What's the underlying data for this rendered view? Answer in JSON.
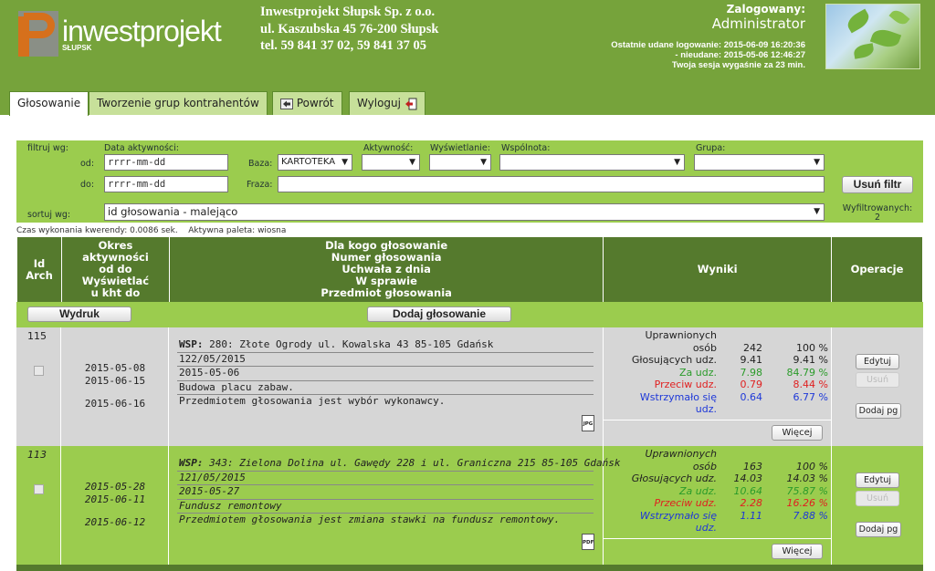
{
  "header": {
    "logo_text": "inwestprojekt",
    "logo_sub": "SŁUPSK",
    "company_name": "Inwestprojekt Słupsk Sp. z o.o.",
    "company_address": "ul. Kaszubska 45 76-200 Słupsk",
    "company_phone": "tel. 59 841 37 02, 59 841 37 05",
    "logged_label": "Zalogowany:",
    "logged_user": "Administrator",
    "last_ok_login": "Ostatnie udane logowanie: 2015-06-09 16:20:36",
    "last_failed_login": "- nieudane: 2015-05-06 12:46:27",
    "session_expiry": "Twoja sesja wygaśnie za 23 min."
  },
  "tabs": [
    {
      "label": "Głosowanie",
      "active": true
    },
    {
      "label": "Tworzenie grup kontrahentów",
      "active": false
    },
    {
      "label": "Powrót",
      "active": false,
      "icon": "back-arrow-icon"
    },
    {
      "label": "Wyloguj",
      "active": false,
      "icon": "logout-icon"
    }
  ],
  "filters": {
    "filter_label": "filtruj wg:",
    "activity_date_label": "Data aktywności:",
    "from_label": "od:",
    "to_label": "do:",
    "from_placeholder": "rrrr-mm-dd",
    "to_placeholder": "rrrr-mm-dd",
    "base_label": "Baza:",
    "base_value": "KARTOTEKA",
    "activity_label": "Aktywność:",
    "display_label": "Wyświetlanie:",
    "community_label": "Wspólnota:",
    "group_label": "Grupa:",
    "phrase_label": "Fraza:",
    "clear_button": "Usuń filtr",
    "sort_label": "sortuj wg:",
    "sort_value": "id głosowania - malejąco",
    "filtered_label": "Wyfiltrowanych:",
    "filtered_count": "2"
  },
  "meta": {
    "query_time": "Czas wykonania kwerendy: 0.0086 sek.",
    "active_palette": "Aktywna paleta: wiosna"
  },
  "table": {
    "col_id": [
      "Id",
      "Arch"
    ],
    "col_period": [
      "Okres",
      "aktywności",
      "od do",
      "Wyświetlać",
      "u kht do"
    ],
    "col_main": [
      "Dla kogo głosowanie",
      "Numer głosowania",
      "Uchwała z dnia",
      "W sprawie",
      "Przedmiot głosowania"
    ],
    "col_results": "Wyniki",
    "col_ops": "Operacje"
  },
  "toolbar": {
    "print_button": "Wydruk",
    "add_vote_button": "Dodaj głosowanie"
  },
  "result_labels": {
    "entitled": [
      "Uprawnionych",
      "osób"
    ],
    "voting": "Głosujących udz.",
    "for": "Za udz.",
    "against": "Przeciw udz.",
    "abstain": [
      "Wstrzymało się",
      "udz."
    ],
    "more_button": "Więcej"
  },
  "op_labels": {
    "edit": "Edytuj",
    "delete": "Usuń",
    "add_pg": "Dodaj pg"
  },
  "colors": {
    "header_green": "#76a33b",
    "panel_green": "#9bcc4e",
    "header_dark": "#557a2d",
    "for_color": "#2a9b2a",
    "against_color": "#e02020",
    "abstain_color": "#1e38d8"
  },
  "rows": [
    {
      "id": "115",
      "date_from": "2015-05-08",
      "date_to": "2015-06-15",
      "display_to": "2015-06-16",
      "wsp_label": "WSP:",
      "community": "280: Złote Ogrody ul. Kowalska 43 85-105 Gdańsk",
      "number": "122/05/2015",
      "resolution_date": "2015-05-06",
      "subject": "Budowa placu zabaw.",
      "description": "Przedmiotem głosowania jest wybór wykonawcy.",
      "file_type": "JPG",
      "entitled": "242",
      "entitled_pct": "100 %",
      "voting": "9.41",
      "voting_pct": "9.41 %",
      "for": "7.98",
      "for_pct": "84.79 %",
      "against": "0.79",
      "against_pct": "8.44 %",
      "abstain": "0.64",
      "abstain_pct": "6.77 %"
    },
    {
      "id": "113",
      "date_from": "2015-05-28",
      "date_to": "2015-06-11",
      "display_to": "2015-06-12",
      "wsp_label": "WSP:",
      "community": "343: Zielona Dolina ul. Gawędy 228 i ul. Graniczna 215 85-105 Gdańsk",
      "number": "121/05/2015",
      "resolution_date": "2015-05-27",
      "subject": "Fundusz remontowy",
      "description": "Przedmiotem głosowania jest zmiana stawki na fundusz remontowy.",
      "file_type": "PDF",
      "entitled": "163",
      "entitled_pct": "100 %",
      "voting": "14.03",
      "voting_pct": "14.03 %",
      "for": "10.64",
      "for_pct": "75.87 %",
      "against": "2.28",
      "against_pct": "16.26 %",
      "abstain": "1.11",
      "abstain_pct": "7.88 %"
    }
  ]
}
